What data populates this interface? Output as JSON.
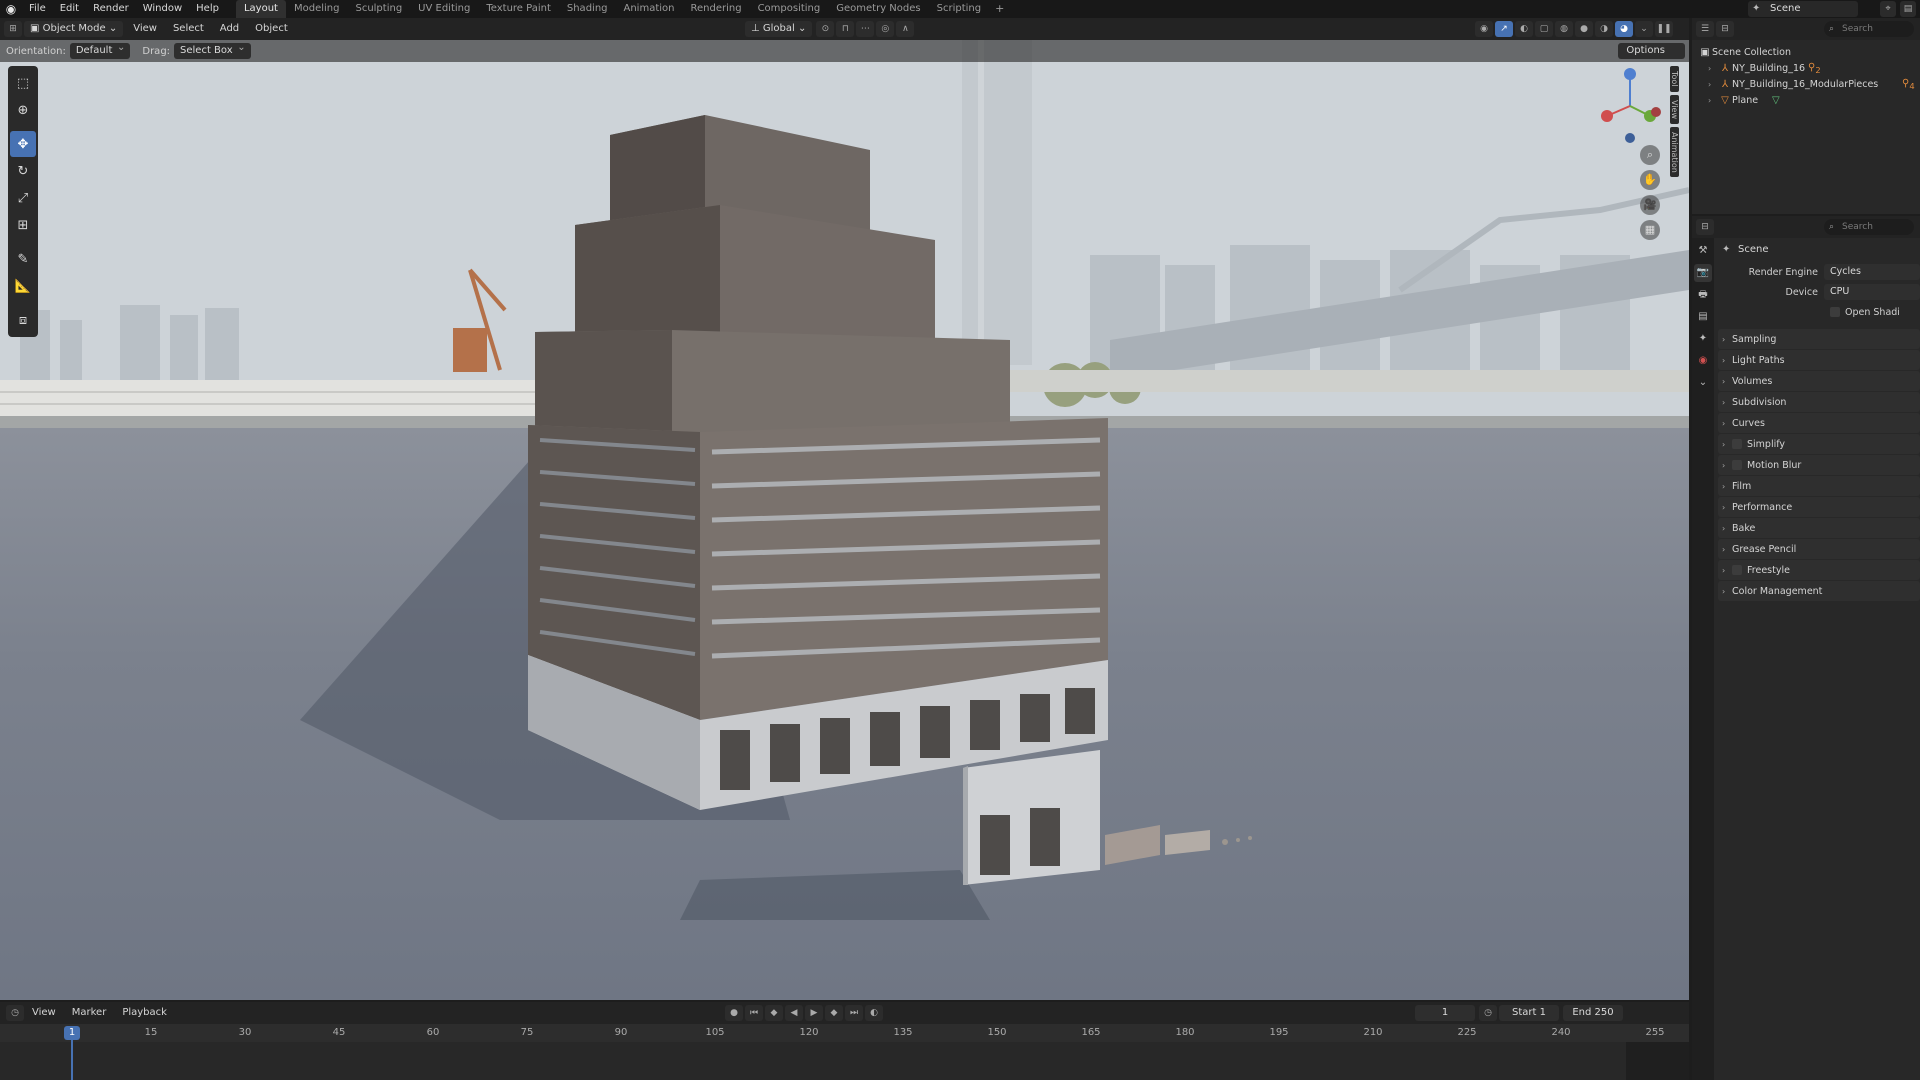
{
  "topbar": {
    "menus": [
      "File",
      "Edit",
      "Render",
      "Window",
      "Help"
    ],
    "workspaces": [
      "Layout",
      "Modeling",
      "Sculpting",
      "UV Editing",
      "Texture Paint",
      "Shading",
      "Animation",
      "Rendering",
      "Compositing",
      "Geometry Nodes",
      "Scripting"
    ],
    "active_workspace": "Layout",
    "add_tab": "+",
    "scene": "Scene"
  },
  "viewport_header": {
    "mode": "Object Mode",
    "menus": [
      "View",
      "Select",
      "Add",
      "Object"
    ],
    "transform_orientation": "Global"
  },
  "tool_header": {
    "orientation_label": "Orientation:",
    "orientation_value": "Default",
    "drag_label": "Drag:",
    "drag_value": "Select Box",
    "options": "Options"
  },
  "toolbar": {
    "tools": [
      "select-box",
      "cursor",
      "move",
      "rotate",
      "scale",
      "transform",
      "annotate",
      "measure",
      "add-cube"
    ],
    "active_tool": "move"
  },
  "side_tabs": [
    "Tool",
    "View",
    "Animation"
  ],
  "outliner": {
    "search_placeholder": "Search",
    "root": "Scene Collection",
    "items": [
      {
        "name": "NY_Building_16",
        "modifier_count": "2"
      },
      {
        "name": "NY_Building_16_ModularPieces",
        "modifier_count": "4"
      },
      {
        "name": "Plane",
        "modifier_count": ""
      }
    ]
  },
  "properties": {
    "search_placeholder": "Search",
    "context": "Scene",
    "render_engine_label": "Render Engine",
    "render_engine": "Cycles",
    "device_label": "Device",
    "device": "CPU",
    "open_shading": "Open Shadi",
    "panels": [
      {
        "label": "Sampling",
        "checkbox": false
      },
      {
        "label": "Light Paths",
        "checkbox": false
      },
      {
        "label": "Volumes",
        "checkbox": false
      },
      {
        "label": "Subdivision",
        "checkbox": false
      },
      {
        "label": "Curves",
        "checkbox": false
      },
      {
        "label": "Simplify",
        "checkbox": true
      },
      {
        "label": "Motion Blur",
        "checkbox": true
      },
      {
        "label": "Film",
        "checkbox": false
      },
      {
        "label": "Performance",
        "checkbox": false
      },
      {
        "label": "Bake",
        "checkbox": false
      },
      {
        "label": "Grease Pencil",
        "checkbox": false
      },
      {
        "label": "Freestyle",
        "checkbox": true
      },
      {
        "label": "Color Management",
        "checkbox": false
      }
    ]
  },
  "timeline": {
    "menus": [
      "View",
      "Marker",
      "Playback"
    ],
    "current_frame": "1",
    "start_label": "Start",
    "start": "1",
    "end_label": "End",
    "end": "250",
    "ticks": [
      "15",
      "30",
      "45",
      "60",
      "75",
      "90",
      "105",
      "120",
      "135",
      "150",
      "165",
      "180",
      "195",
      "210",
      "225",
      "240",
      "255"
    ],
    "playhead": "1"
  },
  "colors": {
    "accent": "#4772b3",
    "panel_bg": "#282828",
    "header_bg": "#232323"
  }
}
